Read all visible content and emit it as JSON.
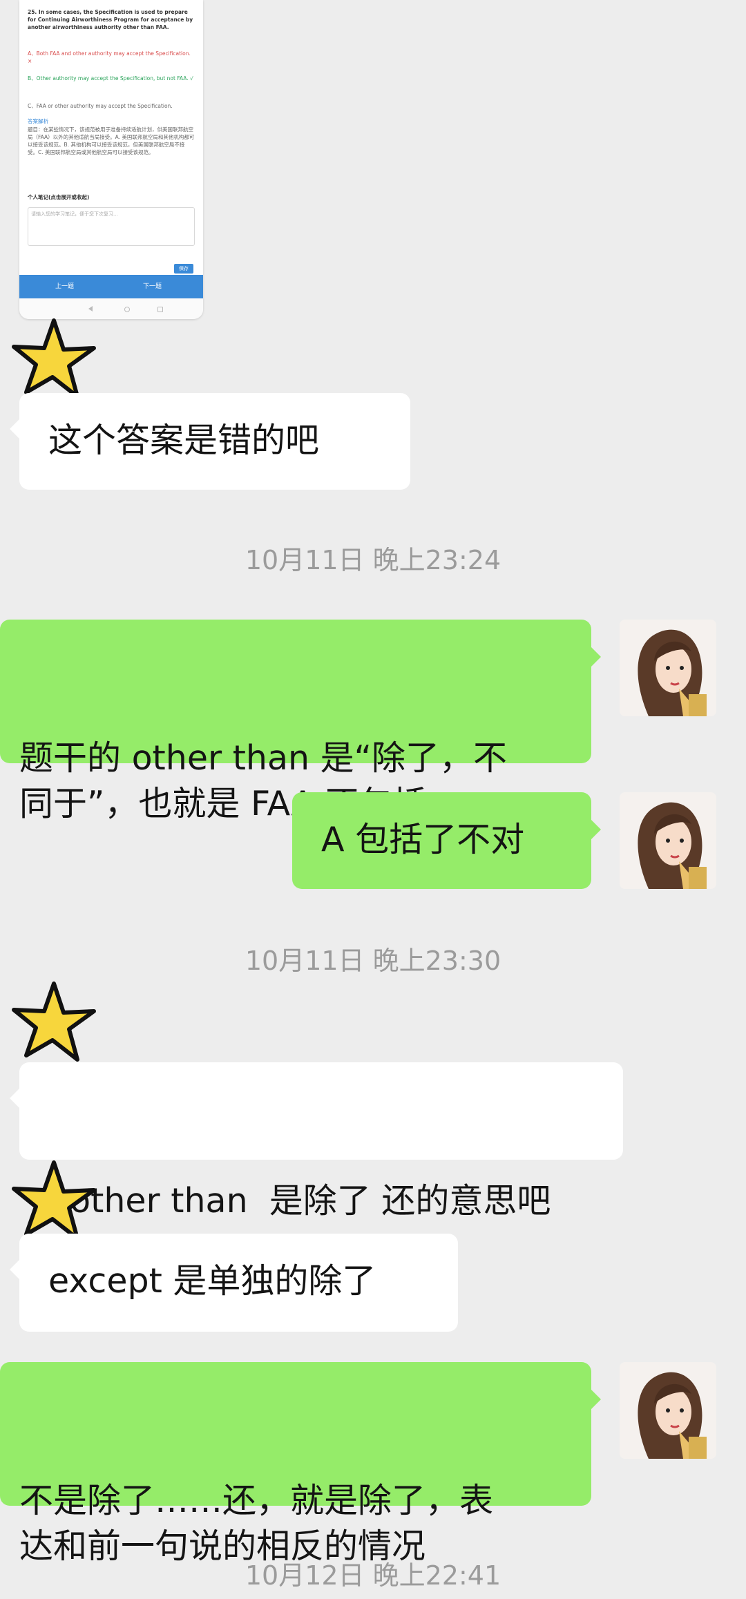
{
  "screenshot": {
    "question": "25. In some cases, the Specification is used to prepare for Continuing Airworthiness Program for acceptance by another airworthiness authority other than FAA.",
    "option_a": "A、Both FAA and other authority may accept the Specification. ×",
    "option_b": "B、Other authority may accept the Specification, but not FAA. √",
    "option_c": "C、FAA or other authority may accept the Specification.",
    "explain_heading": "答案解析",
    "explain_body": "题目：在某些情况下，该规范被用于准备持续适航计划，供美国联邦航空局（FAA）以外的其他适航当局接受。A. 美国联邦航空局和其他机构都可以接受该规范。B. 其他机构可以接受该规范，但美国联邦航空局不接受。C. 美国联邦航空局或其他航空局可以接受该规范。",
    "note_heading": "个人笔记(点击展开或收起)",
    "note_placeholder": "请输入您的学习笔记，便于您下次复习...",
    "save_label": "保存",
    "prev_label": "上一题",
    "next_label": "下一题"
  },
  "messages": [
    {
      "text": "这个答案是错的吧"
    },
    {
      "text": "题干的 other than 是“除了，不\n同于”，也就是 FAA 不包括"
    },
    {
      "text": "A 包括了不对"
    },
    {
      "text": "other than  是除了 还的意思吧"
    },
    {
      "text": "except 是单独的除了"
    },
    {
      "text": "不是除了……还，就是除了，表\n达和前一句说的相反的情况"
    }
  ],
  "timestamps": [
    "10月11日 晚上23:24",
    "10月11日 晚上23:30",
    "10月12日 晚上22:41"
  ],
  "colors": {
    "background": "#ededed",
    "incoming_bubble": "#ffffff",
    "outgoing_bubble": "#95ec69",
    "star": "#f7d63c"
  },
  "icons": {
    "contact_avatar": "star-icon",
    "self_avatar": "girl-avatar"
  }
}
